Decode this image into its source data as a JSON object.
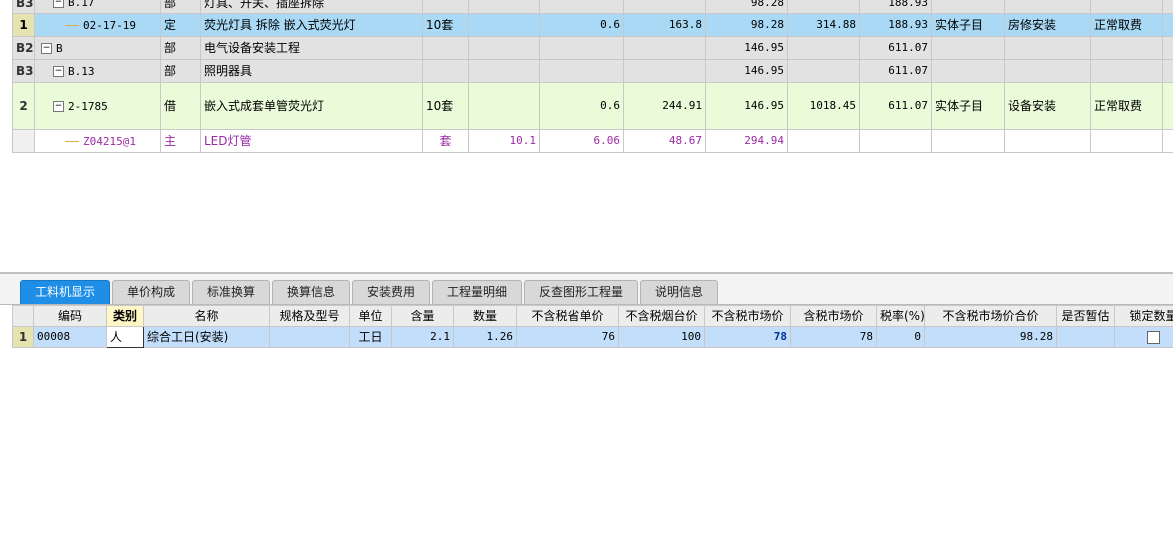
{
  "upper_rows": [
    {
      "num": "B3",
      "code": "B.17",
      "type": "部",
      "name": "灯具、开关、插座拆除",
      "unit": "",
      "qty": "",
      "price": "",
      "c1": "",
      "c2": "98.28",
      "c3": "",
      "c4": "188.93",
      "cat": "",
      "spec": "",
      "fee": ""
    },
    {
      "num": "1",
      "code": "02-17-19",
      "type": "定",
      "name": "荧光灯具 拆除 嵌入式荧光灯",
      "unit": "10套",
      "qty": "",
      "price": "0.6",
      "c1": "163.8",
      "c2": "98.28",
      "c3": "314.88",
      "c4": "188.93",
      "cat": "实体子目",
      "spec": "房修安装",
      "fee": "正常取费"
    },
    {
      "num": "B2",
      "code": "B",
      "type": "部",
      "name": "电气设备安装工程",
      "unit": "",
      "qty": "",
      "price": "",
      "c1": "",
      "c2": "146.95",
      "c3": "",
      "c4": "611.07",
      "cat": "",
      "spec": "",
      "fee": ""
    },
    {
      "num": "B3",
      "code": "B.13",
      "type": "部",
      "name": "照明器具",
      "unit": "",
      "qty": "",
      "price": "",
      "c1": "",
      "c2": "146.95",
      "c3": "",
      "c4": "611.07",
      "cat": "",
      "spec": "",
      "fee": ""
    },
    {
      "num": "2",
      "code": "2-1785",
      "type": "借",
      "name": "嵌入式成套单管荧光灯",
      "unit": "10套",
      "qty": "",
      "price": "0.6",
      "c1": "244.91",
      "c2": "146.95",
      "c3": "1018.45",
      "c4": "611.07",
      "cat": "实体子目",
      "spec": "设备安装",
      "fee": "正常取费"
    },
    {
      "num": "",
      "code": "Z04215@1",
      "type": "主",
      "name": "LED灯管",
      "unit": "套",
      "qty": "10.1",
      "price": "6.06",
      "c1": "48.67",
      "c2": "294.94",
      "c3": "",
      "c4": "",
      "cat": "",
      "spec": "",
      "fee": ""
    }
  ],
  "tabs": [
    "工料机显示",
    "单价构成",
    "标准换算",
    "换算信息",
    "安装费用",
    "工程量明细",
    "反查图形工程量",
    "说明信息"
  ],
  "lower_headers": [
    "编码",
    "类别",
    "名称",
    "规格及型号",
    "单位",
    "含量",
    "数量",
    "不含税省单价",
    "不含税烟台价",
    "不含税市场价",
    "含税市场价",
    "税率(%)",
    "不含税市场价合价",
    "是否暂估",
    "锁定数量"
  ],
  "lower_row": {
    "num": "1",
    "code": "00008",
    "type": "人",
    "name": "综合工日(安装)",
    "spec": "",
    "unit": "工日",
    "content": "2.1",
    "qty": "1.26",
    "p1": "76",
    "p2": "100",
    "p3": "78",
    "p4": "78",
    "tax": "0",
    "total": "98.28",
    "est": ""
  },
  "colors": {
    "active_tab": "#1f8ee6",
    "selected_row": "#a9d9f5",
    "main_material": "#9a2aa6",
    "market_price": "#003399"
  }
}
